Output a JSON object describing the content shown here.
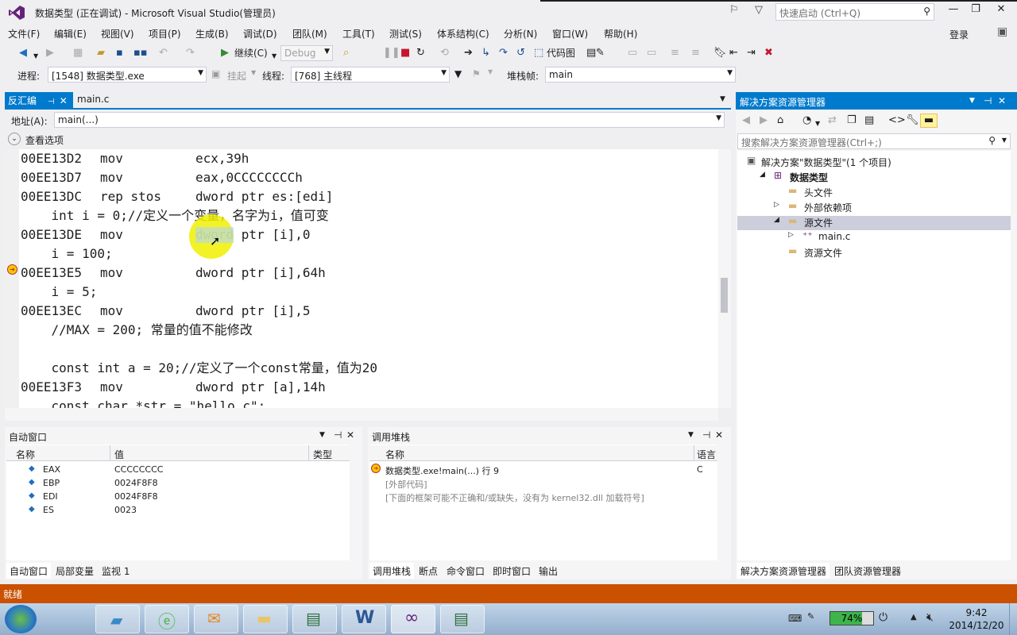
{
  "window": {
    "title": "数据类型 (正在调试) - Microsoft Visual Studio(管理员)",
    "quick_launch_placeholder": "快速启动 (Ctrl+Q)",
    "signin": "登录"
  },
  "menu": [
    "文件(F)",
    "编辑(E)",
    "视图(V)",
    "项目(P)",
    "生成(B)",
    "调试(D)",
    "团队(M)",
    "工具(T)",
    "测试(S)",
    "体系结构(C)",
    "分析(N)",
    "窗口(W)",
    "帮助(H)"
  ],
  "toolbar": {
    "continue_label": "继续(C)",
    "config": "Debug",
    "code_map": "代码图",
    "process_label": "进程:",
    "process_value": "[1548] 数据类型.exe",
    "suspend_label": "挂起",
    "thread_label": "线程:",
    "thread_value": "[768] 主线程",
    "stackframe_label": "堆栈帧:",
    "stackframe_value": "main"
  },
  "editor": {
    "tabs": [
      {
        "label": "反汇编",
        "active": true
      },
      {
        "label": "main.c",
        "active": false
      }
    ],
    "address_label": "地址(A):",
    "address_value": "main(...)",
    "view_options": "查看选项",
    "lines": [
      {
        "type": "asm",
        "addr": "00EE13D2",
        "op": "mov",
        "args": "ecx,39h"
      },
      {
        "type": "asm",
        "addr": "00EE13D7",
        "op": "mov",
        "args": "eax,0CCCCCCCCh"
      },
      {
        "type": "asm",
        "addr": "00EE13DC",
        "op": "rep stos",
        "args": "dword ptr es:[edi]"
      },
      {
        "type": "src",
        "text": "    int i = 0;//定义一个变量，名字为i，值可变"
      },
      {
        "type": "asm",
        "addr": "00EE13DE",
        "op": "mov",
        "args": "dword ptr [i],0"
      },
      {
        "type": "src",
        "text": "    i = 100;"
      },
      {
        "type": "asm",
        "addr": "00EE13E5",
        "op": "mov",
        "args": "dword ptr [i],64h",
        "current": true
      },
      {
        "type": "src",
        "text": "    i = 5;"
      },
      {
        "type": "asm",
        "addr": "00EE13EC",
        "op": "mov",
        "args": "dword ptr [i],5"
      },
      {
        "type": "src",
        "text": "    //MAX = 200; 常量的值不能修改"
      },
      {
        "type": "src",
        "text": ""
      },
      {
        "type": "src",
        "text": "    const int a = 20;//定义了一个const常量，值为20"
      },
      {
        "type": "asm",
        "addr": "00EE13F3",
        "op": "mov",
        "args": "dword ptr [a],14h"
      },
      {
        "type": "src",
        "text": "    const char *str = \"hello c\";"
      }
    ]
  },
  "autos": {
    "title": "自动窗口",
    "columns": [
      "名称",
      "值",
      "类型"
    ],
    "rows": [
      {
        "name": "EAX",
        "value": "CCCCCCCC",
        "type": ""
      },
      {
        "name": "EBP",
        "value": "0024F8F8",
        "type": ""
      },
      {
        "name": "EDI",
        "value": "0024F8F8",
        "type": ""
      },
      {
        "name": "ES",
        "value": "0023",
        "type": ""
      }
    ],
    "tabs": [
      "自动窗口",
      "局部变量",
      "监视 1"
    ]
  },
  "callstack": {
    "title": "调用堆栈",
    "columns": [
      "名称",
      "语言"
    ],
    "rows": [
      {
        "name": "数据类型.exe!main(...) 行 9",
        "lang": "C",
        "current": true
      },
      {
        "name": "[外部代码]",
        "lang": "",
        "gray": true
      },
      {
        "name": "[下面的框架可能不正确和/或缺失，没有为 kernel32.dll 加载符号]",
        "lang": "",
        "gray": true
      }
    ],
    "tabs": [
      "调用堆栈",
      "断点",
      "命令窗口",
      "即时窗口",
      "输出"
    ]
  },
  "solution_explorer": {
    "title": "解决方案资源管理器",
    "search_placeholder": "搜索解决方案资源管理器(Ctrl+;)",
    "tree": [
      {
        "label": "解决方案\"数据类型\"(1 个项目)",
        "level": 0,
        "icon": "solution-icon"
      },
      {
        "label": "数据类型",
        "level": 1,
        "icon": "project-icon",
        "expanded": true,
        "bold": true
      },
      {
        "label": "头文件",
        "level": 2,
        "icon": "folder-icon"
      },
      {
        "label": "外部依赖项",
        "level": 2,
        "icon": "folder-icon",
        "collapsed": true
      },
      {
        "label": "源文件",
        "level": 2,
        "icon": "folder-icon",
        "expanded": true,
        "selected": true
      },
      {
        "label": "main.c",
        "level": 3,
        "icon": "c-file-icon",
        "collapsed": true
      },
      {
        "label": "资源文件",
        "level": 2,
        "icon": "folder-icon"
      }
    ],
    "tabs": [
      "解决方案资源管理器",
      "团队资源管理器"
    ]
  },
  "status": {
    "text": "就绪"
  },
  "taskbar": {
    "battery": "74%",
    "time": "9:42",
    "date": "2014/12/20"
  },
  "colors": {
    "accent": "#007ACC",
    "status_bar": "#CA5100",
    "selection": "#CCE8FF"
  }
}
